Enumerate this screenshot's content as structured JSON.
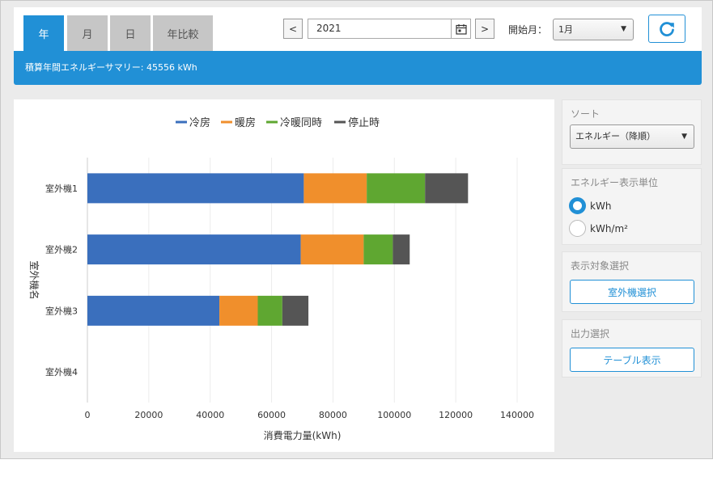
{
  "tabs": [
    {
      "label": "年",
      "active": true
    },
    {
      "label": "月",
      "active": false
    },
    {
      "label": "日",
      "active": false
    },
    {
      "label": "年比較",
      "active": false
    }
  ],
  "date": {
    "value": "2021",
    "prev_label": "<",
    "next_label": ">"
  },
  "start_month": {
    "label": "開始月：",
    "selected": "1月"
  },
  "summary": "積算年間エネルギーサマリー: 45556 kWh",
  "sidebar": {
    "sort": {
      "title": "ソート",
      "selected": "エネルギー（降順）"
    },
    "unit": {
      "title": "エネルギー表示単位",
      "options": [
        "kWh",
        "kWh/m²"
      ],
      "selected": "kWh"
    },
    "target": {
      "title": "表示対象選択",
      "button": "室外機選択"
    },
    "output": {
      "title": "出力選択",
      "button": "テーブル表示"
    }
  },
  "colors": {
    "accent": "#2190d6",
    "cooling": "#3a6fbd",
    "heating": "#f08f2c",
    "simultaneous": "#5fa731",
    "stopped": "#555555"
  },
  "chart_data": {
    "type": "bar",
    "orientation": "horizontal",
    "stacked": true,
    "categories": [
      "室外機1",
      "室外機2",
      "室外機3",
      "室外機4"
    ],
    "series": [
      {
        "name": "冷房",
        "values": [
          70500,
          69500,
          43000,
          0
        ]
      },
      {
        "name": "暖房",
        "values": [
          20500,
          20500,
          12500,
          0
        ]
      },
      {
        "name": "冷暖同時",
        "values": [
          19000,
          9500,
          8000,
          0
        ]
      },
      {
        "name": "停止時",
        "values": [
          14000,
          5500,
          8500,
          0
        ]
      }
    ],
    "xlabel": "消費電力量(kWh)",
    "ylabel": "室外機名",
    "xlim": [
      0,
      140000
    ],
    "xticks": [
      0,
      20000,
      40000,
      60000,
      80000,
      100000,
      120000,
      140000
    ],
    "legend": "top",
    "grid": true
  }
}
